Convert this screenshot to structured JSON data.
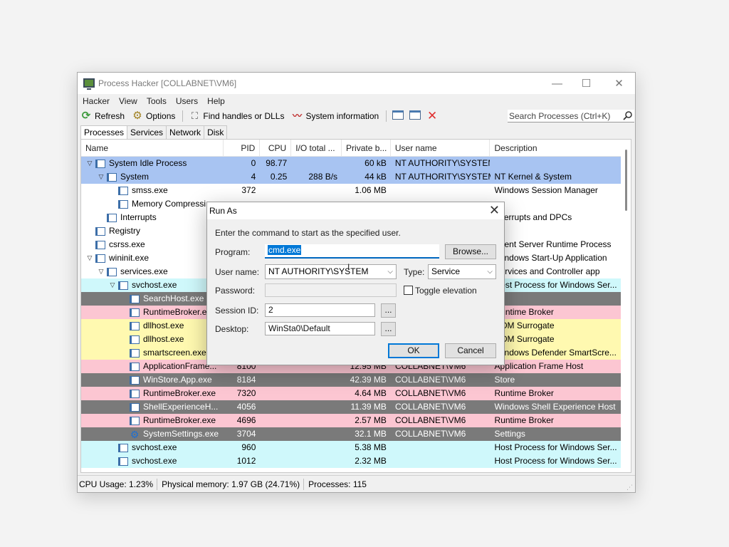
{
  "window": {
    "title": "Process Hacker [COLLABNET\\VM6]",
    "controls": {
      "minimize": "—",
      "maximize": "☐",
      "close": "✕"
    }
  },
  "menu": [
    "Hacker",
    "View",
    "Tools",
    "Users",
    "Help"
  ],
  "toolbar": {
    "refresh": "Refresh",
    "options": "Options",
    "find_handles": "Find handles or DLLs",
    "system_information": "System information",
    "search_placeholder": "Search Processes (Ctrl+K)"
  },
  "tabs": [
    "Processes",
    "Services",
    "Network",
    "Disk"
  ],
  "columns": [
    "Name",
    "PID",
    "CPU",
    "I/O total ...",
    "Private b...",
    "User name",
    "Description"
  ],
  "colors": {
    "selected": "#a8c4f2",
    "service": "#cff8fb",
    "system": "#e8e8e8",
    "own": "#fff9b0",
    "suspended": "#7a7a7a",
    "packed": "#fcc6d2"
  },
  "rows": [
    {
      "name": "System Idle Process",
      "pid": "0",
      "cpu": "98.77",
      "io": "",
      "priv": "60 kB",
      "user": "NT AUTHORITY\\SYSTEM",
      "desc": "",
      "indent": 0,
      "exp": "v",
      "bg": "selected"
    },
    {
      "name": "System",
      "pid": "4",
      "cpu": "0.25",
      "io": "288 B/s",
      "priv": "44 kB",
      "user": "NT AUTHORITY\\SYSTEM",
      "desc": "NT Kernel & System",
      "indent": 1,
      "exp": "v",
      "bg": "selected"
    },
    {
      "name": "smss.exe",
      "pid": "372",
      "cpu": "",
      "io": "",
      "priv": "1.06 MB",
      "user": "",
      "desc": "Windows Session Manager",
      "indent": 2,
      "exp": "",
      "bg": ""
    },
    {
      "name": "Memory Compressi...",
      "pid": "",
      "cpu": "",
      "io": "",
      "priv": "",
      "user": "",
      "desc": "",
      "indent": 2,
      "exp": "",
      "bg": ""
    },
    {
      "name": "Interrupts",
      "pid": "",
      "cpu": "",
      "io": "",
      "priv": "",
      "user": "",
      "desc": "Interrupts and DPCs",
      "indent": 1,
      "exp": "",
      "bg": ""
    },
    {
      "name": "Registry",
      "pid": "",
      "cpu": "",
      "io": "",
      "priv": "",
      "user": "",
      "desc": "",
      "indent": 0,
      "exp": "",
      "bg": ""
    },
    {
      "name": "csrss.exe",
      "pid": "",
      "cpu": "",
      "io": "",
      "priv": "",
      "user": "",
      "desc": "Client Server Runtime Process",
      "indent": 0,
      "exp": "",
      "bg": ""
    },
    {
      "name": "wininit.exe",
      "pid": "",
      "cpu": "",
      "io": "",
      "priv": "",
      "user": "",
      "desc": "Windows Start-Up Application",
      "indent": 0,
      "exp": "v",
      "bg": ""
    },
    {
      "name": "services.exe",
      "pid": "",
      "cpu": "",
      "io": "",
      "priv": "",
      "user": "",
      "desc": "Services and Controller app",
      "indent": 1,
      "exp": "v",
      "bg": ""
    },
    {
      "name": "svchost.exe",
      "pid": "",
      "cpu": "",
      "io": "",
      "priv": "",
      "user": "",
      "desc": "Host Process for Windows Ser...",
      "indent": 2,
      "exp": "v",
      "bg": "service"
    },
    {
      "name": "SearchHost.exe",
      "pid": "",
      "cpu": "",
      "io": "",
      "priv": "",
      "user": "",
      "desc": "",
      "indent": 3,
      "exp": "",
      "bg": "suspended"
    },
    {
      "name": "RuntimeBroker.exe",
      "pid": "",
      "cpu": "",
      "io": "",
      "priv": "",
      "user": "",
      "desc": "Runtime Broker",
      "indent": 3,
      "exp": "",
      "bg": "packed"
    },
    {
      "name": "dllhost.exe",
      "pid": "",
      "cpu": "",
      "io": "",
      "priv": "",
      "user": "",
      "desc": "COM Surrogate",
      "indent": 3,
      "exp": "",
      "bg": "own"
    },
    {
      "name": "dllhost.exe",
      "pid": "",
      "cpu": "",
      "io": "",
      "priv": "",
      "user": "",
      "desc": "COM Surrogate",
      "indent": 3,
      "exp": "",
      "bg": "own"
    },
    {
      "name": "smartscreen.exe",
      "pid": "",
      "cpu": "",
      "io": "",
      "priv": "",
      "user": "",
      "desc": "Windows Defender SmartScre...",
      "indent": 3,
      "exp": "",
      "bg": "own"
    },
    {
      "name": "ApplicationFrame...",
      "pid": "8100",
      "cpu": "",
      "io": "",
      "priv": "12.95 MB",
      "user": "COLLABNET\\VM6",
      "desc": "Application Frame Host",
      "indent": 3,
      "exp": "",
      "bg": "packed"
    },
    {
      "name": "WinStore.App.exe",
      "pid": "8184",
      "cpu": "",
      "io": "",
      "priv": "42.39 MB",
      "user": "COLLABNET\\VM6",
      "desc": "Store",
      "indent": 3,
      "exp": "",
      "bg": "suspended"
    },
    {
      "name": "RuntimeBroker.exe",
      "pid": "7320",
      "cpu": "",
      "io": "",
      "priv": "4.64 MB",
      "user": "COLLABNET\\VM6",
      "desc": "Runtime Broker",
      "indent": 3,
      "exp": "",
      "bg": "packed"
    },
    {
      "name": "ShellExperienceH...",
      "pid": "4056",
      "cpu": "",
      "io": "",
      "priv": "11.39 MB",
      "user": "COLLABNET\\VM6",
      "desc": "Windows Shell Experience Host",
      "indent": 3,
      "exp": "",
      "bg": "suspended"
    },
    {
      "name": "RuntimeBroker.exe",
      "pid": "4696",
      "cpu": "",
      "io": "",
      "priv": "2.57 MB",
      "user": "COLLABNET\\VM6",
      "desc": "Runtime Broker",
      "indent": 3,
      "exp": "",
      "bg": "packed"
    },
    {
      "name": "SystemSettings.exe",
      "pid": "3704",
      "cpu": "",
      "io": "",
      "priv": "32.1 MB",
      "user": "COLLABNET\\VM6",
      "desc": "Settings",
      "indent": 3,
      "exp": "",
      "bg": "suspended",
      "icon": "gear"
    },
    {
      "name": "svchost.exe",
      "pid": "960",
      "cpu": "",
      "io": "",
      "priv": "5.38 MB",
      "user": "",
      "desc": "Host Process for Windows Ser...",
      "indent": 2,
      "exp": "",
      "bg": "service"
    },
    {
      "name": "svchost.exe",
      "pid": "1012",
      "cpu": "",
      "io": "",
      "priv": "2.32 MB",
      "user": "",
      "desc": "Host Process for Windows Ser...",
      "indent": 2,
      "exp": "",
      "bg": "service"
    }
  ],
  "status": {
    "cpu": "CPU Usage: 1.23%",
    "memory": "Physical memory: 1.97 GB (24.71%)",
    "processes": "Processes: 115"
  },
  "dialog": {
    "title": "Run As",
    "intro": "Enter the command to start as the specified user.",
    "program_label": "Program:",
    "program_value": "cmd.exe",
    "browse": "Browse...",
    "username_label": "User name:",
    "username_value": "NT AUTHORITY\\SYSTEM",
    "type_label": "Type:",
    "type_value": "Service",
    "password_label": "Password:",
    "toggle_elevation": "Toggle elevation",
    "session_label": "Session ID:",
    "session_value": "2",
    "desktop_label": "Desktop:",
    "desktop_value": "WinSta0\\Default",
    "ellipsis": "...",
    "ok": "OK",
    "cancel": "Cancel"
  }
}
